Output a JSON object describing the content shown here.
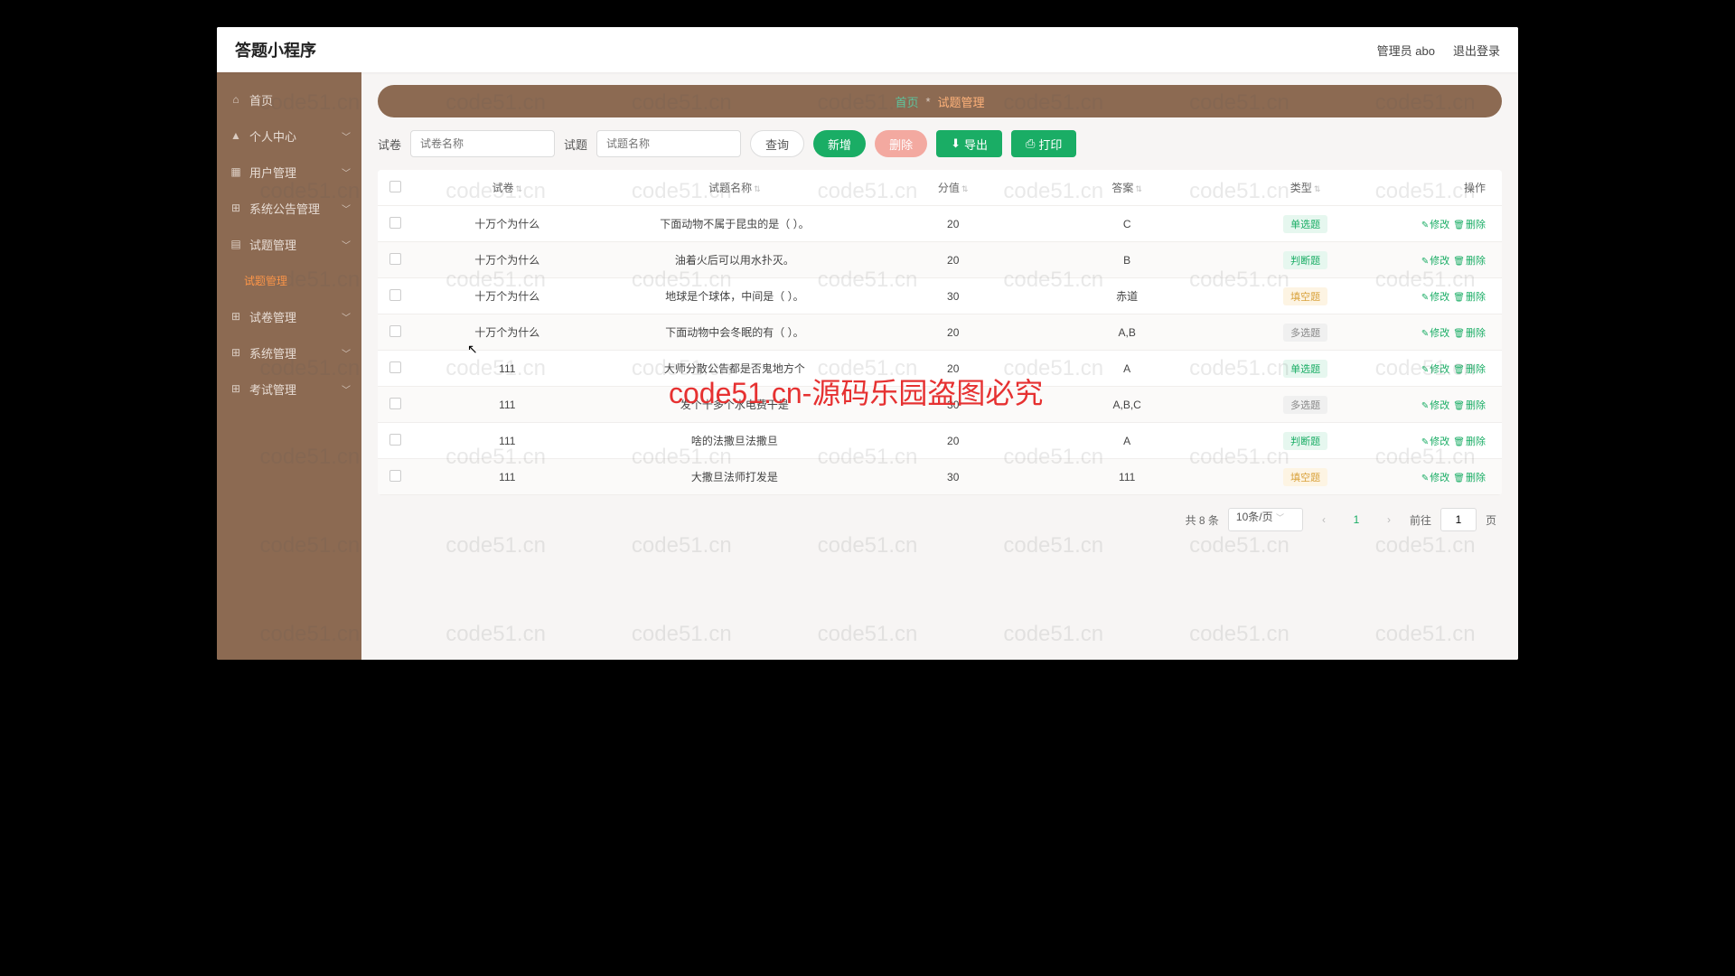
{
  "watermark_text": "code51.cn",
  "watermark_center": "code51.cn-源码乐园盗图必究",
  "topbar": {
    "title": "答题小程序",
    "admin_label": "管理员 abo",
    "logout_label": "退出登录"
  },
  "sidebar": {
    "home": "首页",
    "personal": "个人中心",
    "user_mgmt": "用户管理",
    "notice_mgmt": "系统公告管理",
    "question_mgmt": "试题管理",
    "question_mgmt_sub": "试题管理",
    "paper_mgmt": "试卷管理",
    "system_mgmt": "系统管理",
    "exam_mgmt": "考试管理"
  },
  "breadcrumb": {
    "home": "首页",
    "sep": "*",
    "current": "试题管理"
  },
  "filters": {
    "paper_label": "试卷",
    "paper_placeholder": "试卷名称",
    "question_label": "试题",
    "question_placeholder": "试题名称",
    "search_btn": "查询",
    "add_btn": "新增",
    "del_btn": "删除",
    "export_btn": "导出",
    "print_btn": "打印"
  },
  "table": {
    "headers": {
      "paper": "试卷",
      "qname": "试题名称",
      "score": "分值",
      "answer": "答案",
      "type": "类型",
      "ops": "操作"
    },
    "op_edit": "修改",
    "op_del": "删除",
    "tag_single": "单选题",
    "tag_judge": "判断题",
    "tag_fill": "填空题",
    "tag_multi": "多选题",
    "rows": [
      {
        "paper": "十万个为什么",
        "qname": "下面动物不属于昆虫的是（ ）。",
        "score": "20",
        "answer": "C",
        "type": "single"
      },
      {
        "paper": "十万个为什么",
        "qname": "油着火后可以用水扑灭。",
        "score": "20",
        "answer": "B",
        "type": "judge"
      },
      {
        "paper": "十万个为什么",
        "qname": "地球是个球体，中间是（ ）。",
        "score": "30",
        "answer": "赤道",
        "type": "fill"
      },
      {
        "paper": "十万个为什么",
        "qname": "下面动物中会冬眠的有（ ）。",
        "score": "20",
        "answer": "A,B",
        "type": "multi"
      },
      {
        "paper": "111",
        "qname": "大师分散公告都是否鬼地方个",
        "score": "20",
        "answer": "A",
        "type": "single"
      },
      {
        "paper": "111",
        "qname": "发个十多个水电费干是",
        "score": "30",
        "answer": "A,B,C",
        "type": "multi"
      },
      {
        "paper": "111",
        "qname": "啥的法撒旦法撒旦",
        "score": "20",
        "answer": "A",
        "type": "judge"
      },
      {
        "paper": "111",
        "qname": "大撒旦法师打发是",
        "score": "30",
        "answer": "111",
        "type": "fill"
      }
    ]
  },
  "pager": {
    "total": "共 8 条",
    "per_page": "10条/页",
    "current": "1",
    "goto_label": "前往",
    "goto_value": "1",
    "page_suffix": "页"
  }
}
